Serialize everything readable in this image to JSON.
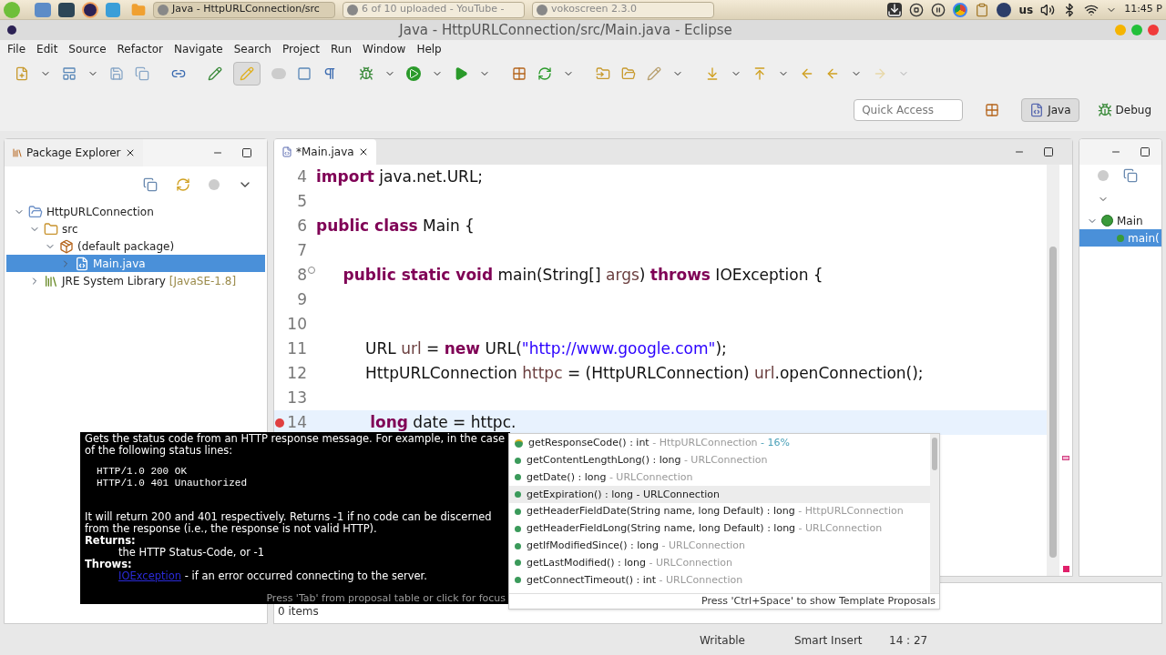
{
  "taskbar": {
    "windows": [
      {
        "label": "Java - HttpURLConnection/src",
        "selected": true
      },
      {
        "label": "6 of 10 uploaded - YouTube -",
        "selected": false
      },
      {
        "label": "vokoscreen 2.3.0",
        "selected": false
      }
    ],
    "layout": "us",
    "clock": "11:45 P"
  },
  "window": {
    "title": "Java - HttpURLConnection/src/Main.java - Eclipse"
  },
  "menu": [
    "File",
    "Edit",
    "Source",
    "Refactor",
    "Navigate",
    "Search",
    "Project",
    "Run",
    "Window",
    "Help"
  ],
  "quick_access": {
    "placeholder": "Quick Access"
  },
  "perspectives": [
    {
      "label": "Java",
      "kind": "java",
      "selected": true
    },
    {
      "label": "Debug",
      "kind": "debug",
      "selected": false
    }
  ],
  "package_explorer": {
    "title": "Package Explorer",
    "tree": [
      {
        "label": "HttpURLConnection",
        "kind": "project",
        "expanded": true,
        "selected": false,
        "children": [
          {
            "label": "src",
            "kind": "folder",
            "expanded": true,
            "selected": false,
            "children": [
              {
                "label": "(default package)",
                "kind": "package",
                "expanded": true,
                "selected": false,
                "children": [
                  {
                    "label": "Main.java",
                    "kind": "java",
                    "expanded": false,
                    "selected": true
                  }
                ]
              }
            ]
          },
          {
            "label": "JRE System Library",
            "suffix": "[JavaSE-1.8]",
            "kind": "library",
            "expanded": false,
            "selected": false
          }
        ]
      }
    ]
  },
  "editor": {
    "tab": "*Main.java",
    "lines": [
      {
        "number": "4",
        "current": false,
        "error": false,
        "foldable": false,
        "tokens": [
          {
            "kind": "keyword",
            "text": "import"
          },
          {
            "kind": "plain",
            "text": " java.net.URL;"
          }
        ]
      },
      {
        "number": "5",
        "current": false,
        "error": false,
        "foldable": false
      },
      {
        "number": "6",
        "current": false,
        "error": false,
        "foldable": false,
        "tokens": [
          {
            "kind": "keyword",
            "text": "public class"
          },
          {
            "kind": "plain",
            "text": " Main {"
          }
        ]
      },
      {
        "number": "7",
        "current": false,
        "error": false,
        "foldable": false
      },
      {
        "number": "8",
        "current": false,
        "error": false,
        "foldable": true,
        "tokens": [
          {
            "kind": "keyword",
            "text": "     public static void"
          },
          {
            "kind": "plain",
            "text": " main(String[] "
          },
          {
            "kind": "var",
            "text": "args"
          },
          {
            "kind": "plain",
            "text": ") "
          },
          {
            "kind": "keyword",
            "text": "throws"
          },
          {
            "kind": "plain",
            "text": " IOException {"
          }
        ]
      },
      {
        "number": "9",
        "current": false,
        "error": false,
        "foldable": false
      },
      {
        "number": "10",
        "current": false,
        "error": false,
        "foldable": false
      },
      {
        "number": "11",
        "current": false,
        "error": false,
        "foldable": false,
        "tokens": [
          {
            "kind": "plain",
            "text": "          URL "
          },
          {
            "kind": "var",
            "text": "url"
          },
          {
            "kind": "plain",
            "text": " = "
          },
          {
            "kind": "keyword",
            "text": "new"
          },
          {
            "kind": "plain",
            "text": " URL("
          },
          {
            "kind": "string",
            "text": "\"http://www.google.com\""
          },
          {
            "kind": "plain",
            "text": ");"
          }
        ]
      },
      {
        "number": "12",
        "current": false,
        "error": false,
        "foldable": false,
        "tokens": [
          {
            "kind": "plain",
            "text": "          HttpURLConnection "
          },
          {
            "kind": "var",
            "text": "httpc"
          },
          {
            "kind": "plain",
            "text": " = (HttpURLConnection) "
          },
          {
            "kind": "var",
            "text": "url"
          },
          {
            "kind": "plain",
            "text": ".openConnection();"
          }
        ]
      },
      {
        "number": "13",
        "current": false,
        "error": false,
        "foldable": false
      },
      {
        "number": "14",
        "current": true,
        "error": true,
        "foldable": false,
        "tokens": [
          {
            "kind": "keyword",
            "text": "          long"
          },
          {
            "kind": "plain",
            "text": " date = httpc."
          }
        ]
      }
    ]
  },
  "outline": {
    "tree": [
      {
        "label": "Main",
        "kind": "class",
        "expanded": true,
        "selected": false,
        "children": [
          {
            "label": "main(",
            "kind": "method",
            "expanded": false,
            "selected": true
          }
        ]
      }
    ]
  },
  "javadoc": {
    "intro": "Gets the status code from an HTTP response message. For example, in the case of the following status lines:",
    "code": [
      "HTTP/1.0 200 OK",
      "HTTP/1.0 401 Unauthorized"
    ],
    "body": "It will return 200 and 401 respectively. Returns -1 if no code can be discerned from the response (i.e., the response is not valid HTTP).",
    "returns_label": "Returns:",
    "returns": "the HTTP Status-Code, or -1",
    "throws_label": "Throws:",
    "throws_link": "IOException",
    "throws": " - if an error occurred connecting to the server.",
    "hint": "Press 'Tab' from proposal table or click for focus"
  },
  "proposals": {
    "items": [
      {
        "kind": "ranked",
        "name": "getResponseCode() : int",
        "type": " - HttpURLConnection",
        "relevance": " - 16%",
        "selected": false
      },
      {
        "kind": "method",
        "name": "getContentLengthLong() : long",
        "type": " - URLConnection",
        "selected": false
      },
      {
        "kind": "method",
        "name": "getDate() : long",
        "type": " - URLConnection",
        "selected": false
      },
      {
        "kind": "method",
        "name": "getExpiration() : long",
        "type": " - URLConnection",
        "selected": true
      },
      {
        "kind": "method",
        "name": "getHeaderFieldDate(String name, long Default) : long",
        "type": " - HttpURLConnection",
        "selected": false
      },
      {
        "kind": "method",
        "name": "getHeaderFieldLong(String name, long Default) : long",
        "type": " - URLConnection",
        "selected": false
      },
      {
        "kind": "method",
        "name": "getIfModifiedSince() : long",
        "type": " - URLConnection",
        "selected": false
      },
      {
        "kind": "method",
        "name": "getLastModified() : long",
        "type": " - URLConnection",
        "selected": false
      },
      {
        "kind": "method",
        "name": "getConnectTimeout() : int",
        "type": " - URLConnection",
        "selected": false
      }
    ],
    "hint": "Press 'Ctrl+Space' to show Template Proposals"
  },
  "bottom_panel": {
    "status": "0 items"
  },
  "status_bar": [
    "Writable",
    "Smart Insert",
    "14 : 27"
  ]
}
